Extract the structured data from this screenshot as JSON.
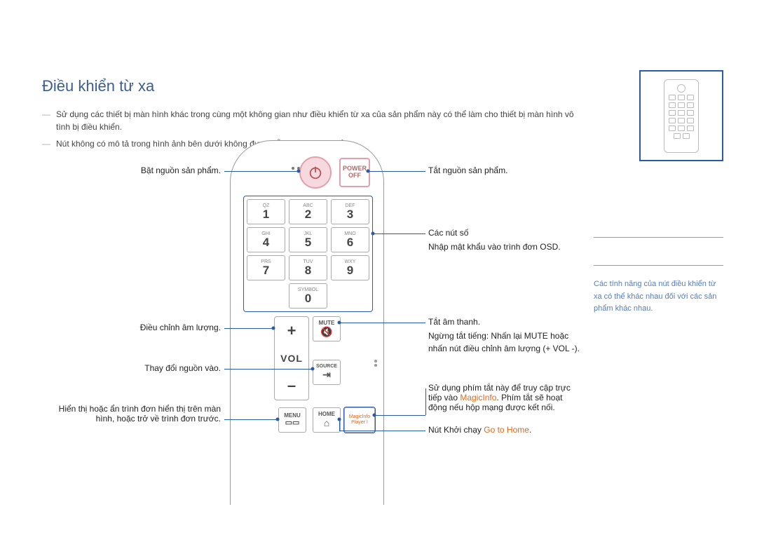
{
  "title": "Điều khiển từ xa",
  "notes": [
    "Sử dụng các thiết bị màn hình khác trong cùng một không gian như điều khiển từ xa của sản phẩm này có thể làm cho thiết bị màn hình vô tình bị điều khiển.",
    "Nút không có mô tả trong hình ảnh bên dưới không được hỗ trợ trên sản phẩm."
  ],
  "sidenote": "Các tính năng của nút điều khiển từ xa có thể khác nhau đối với các sản phẩm khác nhau.",
  "remote": {
    "power_off_label": "POWER\nOFF",
    "keypad": {
      "labels": [
        "QZ",
        "ABC",
        "DEF",
        "GHI",
        "JKL",
        "MNO",
        "PRS",
        "TUV",
        "WXY",
        "SYMBOL"
      ],
      "digits": [
        "1",
        "2",
        "3",
        "4",
        "5",
        "6",
        "7",
        "8",
        "9",
        "0"
      ]
    },
    "vol_plus": "+",
    "vol_label": "VOL",
    "vol_minus": "–",
    "mute_label": "MUTE",
    "source_label": "SOURCE",
    "menu_label": "MENU",
    "home_label": "HOME",
    "magicinfo_line1": "MagicInfo",
    "magicinfo_line2": "Player I"
  },
  "callouts": {
    "power_on": "Bật nguồn sản phẩm.",
    "adjust_volume": "Điều chỉnh âm lượng.",
    "change_source": "Thay đổi nguồn vào.",
    "show_menu": "Hiển thị hoặc ẩn trình đơn hiển thị trên màn hình, hoặc trở về trình đơn trước.",
    "power_off": "Tắt nguồn sản phẩm.",
    "number_buttons": "Các nút số",
    "number_sub": "Nhập mật khẩu vào trình đơn OSD.",
    "mute": "Tắt âm thanh.",
    "mute_sub": "Ngừng tắt tiếng: Nhấn lại MUTE hoặc nhấn nút điều chỉnh âm lượng (+ VOL -).",
    "magicinfo_pre": "Sử dụng phím tắt này để truy cập trực tiếp vào ",
    "magicinfo_hl": "MagicInfo",
    "magicinfo_post": ". Phím tắt sẽ hoạt động nếu hộp mạng được kết nối.",
    "home_pre": "Nút Khởi chạy ",
    "home_hl": "Go to Home",
    "home_post": "."
  }
}
